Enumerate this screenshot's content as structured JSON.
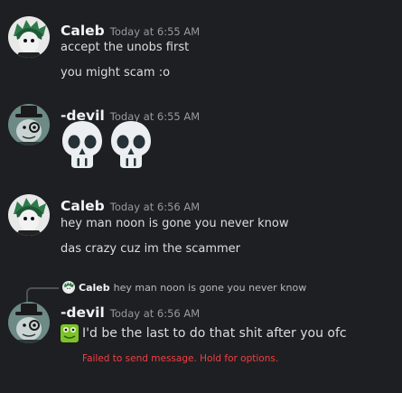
{
  "messages": [
    {
      "author": "Caleb",
      "timestamp": "Today at 6:55 AM",
      "lines": [
        "accept the unobs first",
        "you might scam :o"
      ]
    },
    {
      "author": "-devil",
      "timestamp": "Today at 6:55 AM",
      "emojis": [
        "skull-emoji",
        "skull-emoji"
      ]
    },
    {
      "author": "Caleb",
      "timestamp": "Today at 6:56 AM",
      "lines": [
        "hey man noon is gone you never know",
        "das crazy cuz im the scammer"
      ]
    },
    {
      "reply": {
        "author": "Caleb",
        "text": "hey man noon is gone you never know"
      },
      "author": "-devil",
      "timestamp": "Today at 6:56 AM",
      "lines": [
        "I'd be the last to do that shit after you ofc"
      ],
      "error": "Failed to send message. Hold for options."
    }
  ],
  "colors": {
    "background": "#1e1f22",
    "username": "#f2f3f5",
    "timestamp": "#949ba4",
    "text": "#dbdee1",
    "error": "#f23f43"
  }
}
